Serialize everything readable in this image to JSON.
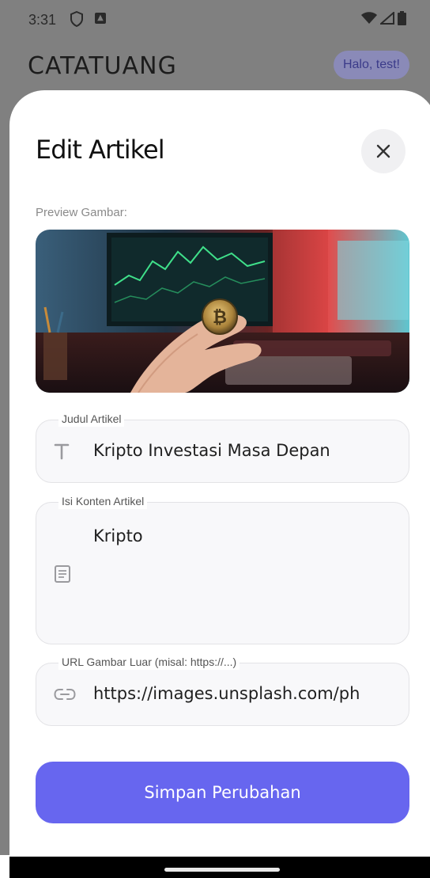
{
  "status_bar": {
    "time": "3:31"
  },
  "app": {
    "title": "CATATUANG",
    "greeting": "Halo, test!"
  },
  "sheet": {
    "title": "Edit Artikel",
    "close_icon": "close-icon",
    "preview_label": "Preview Gambar:"
  },
  "form": {
    "title_field": {
      "label": "Judul Artikel",
      "value": "Kripto Investasi Masa Depan",
      "icon": "text-title-icon"
    },
    "content_field": {
      "label": "Isi Konten Artikel",
      "value": "Kripto",
      "icon": "article-icon"
    },
    "url_field": {
      "label": "URL Gambar Luar (misal: https://...)",
      "value": "https://images.unsplash.com/ph",
      "icon": "link-icon"
    },
    "submit_label": "Simpan Perubahan"
  },
  "colors": {
    "accent": "#6766ef",
    "overlay": "#808080"
  }
}
